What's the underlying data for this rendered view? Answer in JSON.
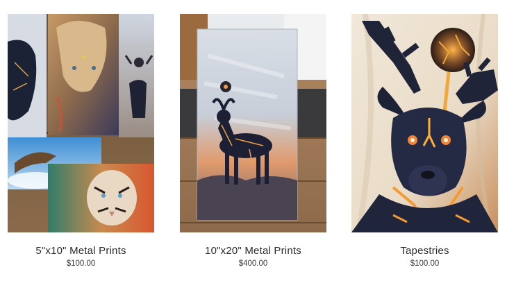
{
  "products": [
    {
      "title": "5\"x10\" Metal Prints",
      "price": "$100.00",
      "image": "metal-prints-5x10-photo"
    },
    {
      "title": "10\"x20\" Metal Prints",
      "price": "$400.00",
      "image": "metal-prints-10x20-photo"
    },
    {
      "title": "Tapestries",
      "price": "$100.00",
      "image": "tapestry-photo"
    }
  ]
}
